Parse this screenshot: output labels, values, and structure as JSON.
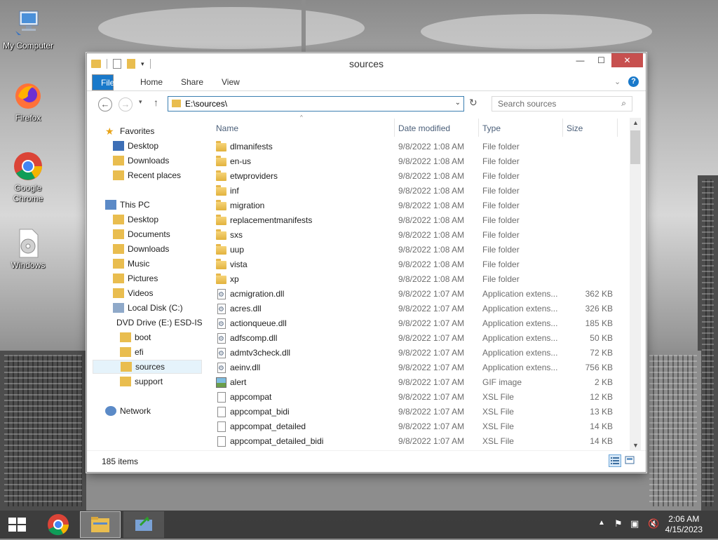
{
  "desktop": {
    "icons": [
      {
        "label": "My Computer"
      },
      {
        "label": "Firefox"
      },
      {
        "label": "Google Chrome"
      },
      {
        "label": "Windows"
      }
    ]
  },
  "window": {
    "title": "sources",
    "ribbon_tabs": [
      "File",
      "Home",
      "Share",
      "View"
    ],
    "address": "E:\\sources\\",
    "search_placeholder": "Search sources",
    "columns": {
      "name": "Name",
      "date": "Date modified",
      "type": "Type",
      "size": "Size"
    },
    "nav": {
      "favorites": "Favorites",
      "fav_items": [
        "Desktop",
        "Downloads",
        "Recent places"
      ],
      "this_pc": "This PC",
      "pc_items": [
        "Desktop",
        "Documents",
        "Downloads",
        "Music",
        "Pictures",
        "Videos",
        "Local Disk (C:)",
        "DVD Drive (E:) ESD-IS"
      ],
      "dvd_children": [
        "boot",
        "efi",
        "sources",
        "support"
      ],
      "network": "Network"
    },
    "files": [
      {
        "name": "dlmanifests",
        "date": "9/8/2022 1:08 AM",
        "type": "File folder",
        "size": "",
        "kind": "folder"
      },
      {
        "name": "en-us",
        "date": "9/8/2022 1:08 AM",
        "type": "File folder",
        "size": "",
        "kind": "folder"
      },
      {
        "name": "etwproviders",
        "date": "9/8/2022 1:08 AM",
        "type": "File folder",
        "size": "",
        "kind": "folder"
      },
      {
        "name": "inf",
        "date": "9/8/2022 1:08 AM",
        "type": "File folder",
        "size": "",
        "kind": "folder"
      },
      {
        "name": "migration",
        "date": "9/8/2022 1:08 AM",
        "type": "File folder",
        "size": "",
        "kind": "folder"
      },
      {
        "name": "replacementmanifests",
        "date": "9/8/2022 1:08 AM",
        "type": "File folder",
        "size": "",
        "kind": "folder"
      },
      {
        "name": "sxs",
        "date": "9/8/2022 1:08 AM",
        "type": "File folder",
        "size": "",
        "kind": "folder"
      },
      {
        "name": "uup",
        "date": "9/8/2022 1:08 AM",
        "type": "File folder",
        "size": "",
        "kind": "folder"
      },
      {
        "name": "vista",
        "date": "9/8/2022 1:08 AM",
        "type": "File folder",
        "size": "",
        "kind": "folder"
      },
      {
        "name": "xp",
        "date": "9/8/2022 1:08 AM",
        "type": "File folder",
        "size": "",
        "kind": "folder"
      },
      {
        "name": "acmigration.dll",
        "date": "9/8/2022 1:07 AM",
        "type": "Application extens...",
        "size": "362 KB",
        "kind": "dll"
      },
      {
        "name": "acres.dll",
        "date": "9/8/2022 1:07 AM",
        "type": "Application extens...",
        "size": "326 KB",
        "kind": "dll"
      },
      {
        "name": "actionqueue.dll",
        "date": "9/8/2022 1:07 AM",
        "type": "Application extens...",
        "size": "185 KB",
        "kind": "dll"
      },
      {
        "name": "adfscomp.dll",
        "date": "9/8/2022 1:07 AM",
        "type": "Application extens...",
        "size": "50 KB",
        "kind": "dll"
      },
      {
        "name": "admtv3check.dll",
        "date": "9/8/2022 1:07 AM",
        "type": "Application extens...",
        "size": "72 KB",
        "kind": "dll"
      },
      {
        "name": "aeinv.dll",
        "date": "9/8/2022 1:07 AM",
        "type": "Application extens...",
        "size": "756 KB",
        "kind": "dll"
      },
      {
        "name": "alert",
        "date": "9/8/2022 1:07 AM",
        "type": "GIF image",
        "size": "2 KB",
        "kind": "gif"
      },
      {
        "name": "appcompat",
        "date": "9/8/2022 1:07 AM",
        "type": "XSL File",
        "size": "12 KB",
        "kind": "file"
      },
      {
        "name": "appcompat_bidi",
        "date": "9/8/2022 1:07 AM",
        "type": "XSL File",
        "size": "13 KB",
        "kind": "file"
      },
      {
        "name": "appcompat_detailed",
        "date": "9/8/2022 1:07 AM",
        "type": "XSL File",
        "size": "14 KB",
        "kind": "file"
      },
      {
        "name": "appcompat_detailed_bidi",
        "date": "9/8/2022 1:07 AM",
        "type": "XSL File",
        "size": "14 KB",
        "kind": "file"
      }
    ],
    "status": "185 items"
  },
  "taskbar": {
    "time": "2:06 AM",
    "date": "4/15/2023"
  }
}
